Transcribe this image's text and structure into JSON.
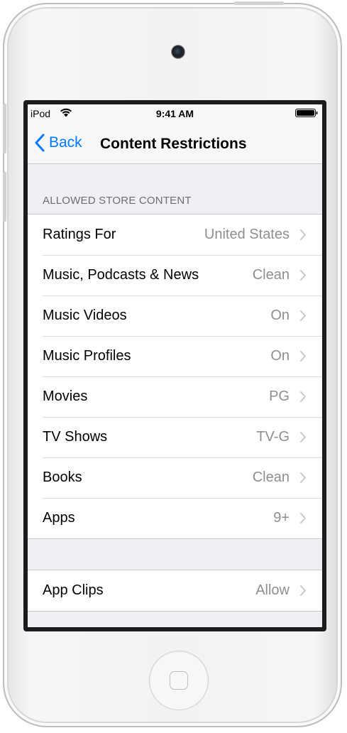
{
  "status_bar": {
    "carrier": "iPod",
    "time": "9:41 AM"
  },
  "nav": {
    "back_label": "Back",
    "title": "Content Restrictions"
  },
  "section_header": "ALLOWED STORE CONTENT",
  "rows": [
    {
      "label": "Ratings For",
      "value": "United States"
    },
    {
      "label": "Music, Podcasts & News",
      "value": "Clean"
    },
    {
      "label": "Music Videos",
      "value": "On"
    },
    {
      "label": "Music Profiles",
      "value": "On"
    },
    {
      "label": "Movies",
      "value": "PG"
    },
    {
      "label": "TV Shows",
      "value": "TV-G"
    },
    {
      "label": "Books",
      "value": "Clean"
    },
    {
      "label": "Apps",
      "value": "9+"
    }
  ],
  "rows2": [
    {
      "label": "App Clips",
      "value": "Allow"
    }
  ],
  "colors": {
    "accent": "#007aff",
    "background": "#efeff4",
    "secondary_text": "#8e8e93",
    "chevron": "#c7c7cc"
  },
  "icons": [
    "wifi-icon",
    "battery-icon",
    "back-chevron-icon",
    "chevron-right-icon",
    "camera",
    "home-button"
  ]
}
